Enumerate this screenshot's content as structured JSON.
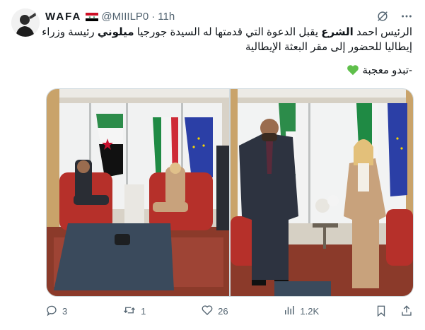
{
  "author": {
    "display_name": "WAFA",
    "handle": "@MIIILP0",
    "separator": "·",
    "time": "11h",
    "flag_icon": "syria-flag-icon"
  },
  "tweet": {
    "line1_a": "الرئيس احمد ",
    "line1_b": "الشرع",
    "line1_c": " يقبل الدعوة التي قدمتها له السيدة جورجيا ",
    "line1_d": "ميلوني",
    "line1_e": " رئيسة وزراء",
    "line2": "إيطاليا للحضور إلى مقر البعثة الإيطالية",
    "line3": "-تبدو معجبة",
    "emoji": "green-heart-icon"
  },
  "actions": {
    "replies": "3",
    "reposts": "1",
    "likes": "26",
    "views": "1.2K"
  },
  "colors": {
    "text": "#0f1419",
    "muted": "#536471",
    "border": "#cfd9de",
    "heart": "#5fbf4b"
  }
}
